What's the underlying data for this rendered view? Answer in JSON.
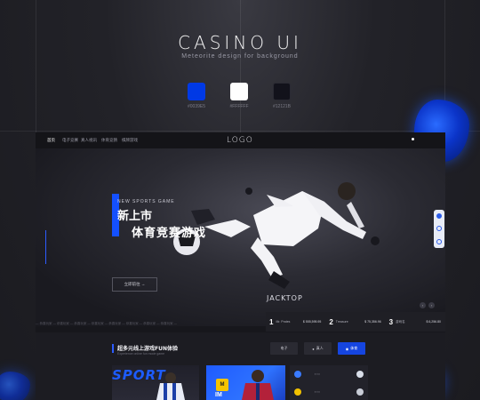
{
  "hero": {
    "title": "CASINO UI",
    "subtitle": "Meteorite design for background"
  },
  "palette": [
    {
      "label": "#0039E5",
      "color": "#0039E5"
    },
    {
      "label": "#FFFFFF",
      "color": "#FFFFFF"
    },
    {
      "label": "#12121B",
      "color": "#12121B"
    }
  ],
  "mock": {
    "nav": [
      "首页",
      "电子竞赛",
      "真人视讯",
      "体育竞猜",
      "棋牌游戏"
    ],
    "logo": "LOGO",
    "banner": {
      "tag": "NEW SPORTS GAME",
      "headline_1": "新上市",
      "headline_2": "体育竞赛游戏",
      "cta": "立即前往 →"
    },
    "jackpot": {
      "title": "JACKTOP",
      "items": [
        {
          "rank": "1",
          "name": "Mr. Prates",
          "value": "$ 555,595.95"
        },
        {
          "rank": "2",
          "name": "Treasure",
          "value": "$ 75,356.96"
        },
        {
          "rank": "3",
          "name": "游戏名",
          "value": "$ 6,256.80"
        }
      ]
    },
    "ticker": "— 恭喜玩家 — 恭喜玩家 — 恭喜玩家 — 恭喜玩家 — 恭喜玩家 — 恭喜玩家 — 恭喜玩家 — 恭喜玩家 —",
    "section": {
      "title": "超多元线上游戏FUN体验",
      "subtitle": "Experience online fun mode game",
      "chips": [
        {
          "label": "电子",
          "active": false
        },
        {
          "label": "真人",
          "active": false
        },
        {
          "label": "体育",
          "active": true
        }
      ],
      "sport_word": "SPORT",
      "im_text": "IM"
    }
  }
}
